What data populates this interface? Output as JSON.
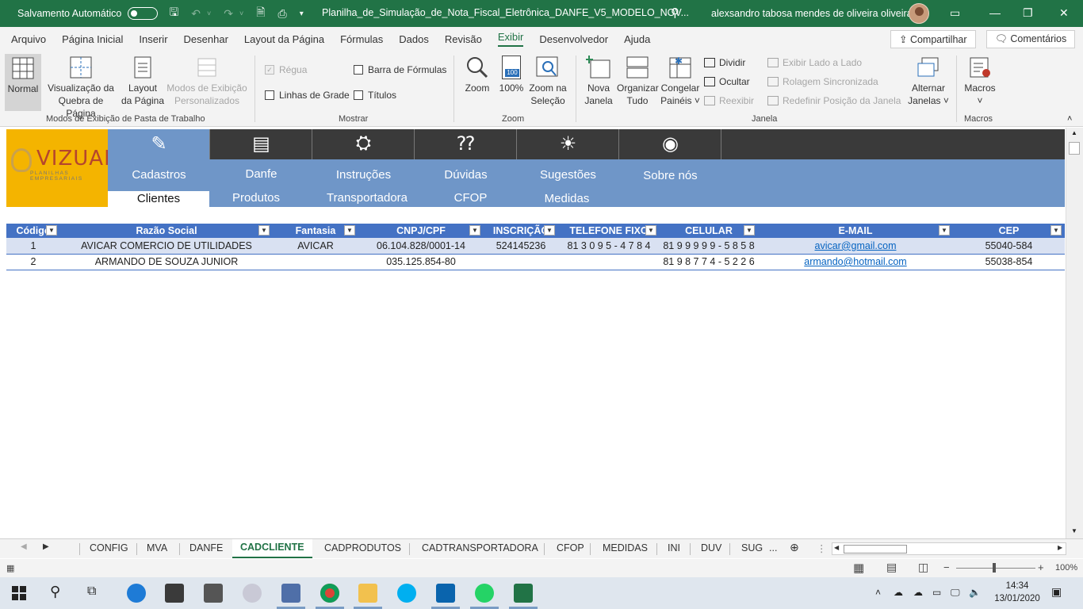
{
  "titlebar": {
    "autosave_label": "Salvamento Automático",
    "doc_title": "Planilha_de_Simulação_de_Nota_Fiscal_Eletrônica_DANFE_V5_MODELO_NOV...",
    "user_name": "alexsandro tabosa mendes de oliveira oliveira"
  },
  "menu": {
    "items": [
      "Arquivo",
      "Página Inicial",
      "Inserir",
      "Desenhar",
      "Layout da Página",
      "Fórmulas",
      "Dados",
      "Revisão",
      "Exibir",
      "Desenvolvedor",
      "Ajuda"
    ],
    "active": "Exibir",
    "share_label": "Compartilhar",
    "comments_label": "Comentários"
  },
  "ribbon": {
    "views": {
      "normal": "Normal",
      "page_break_1": "Visualização da",
      "page_break_2": "Quebra de Página",
      "layout_1": "Layout",
      "layout_2": "da Página",
      "custom_1": "Modos de Exibição",
      "custom_2": "Personalizados",
      "group": "Modos de Exibição de Pasta de Trabalho"
    },
    "show": {
      "ruler": "Régua",
      "formula_bar": "Barra de Fórmulas",
      "gridlines": "Linhas de Grade",
      "headings": "Títulos",
      "group": "Mostrar"
    },
    "zoom": {
      "zoom": "Zoom",
      "hundred": "100%",
      "hundred_icon": "100",
      "selection_1": "Zoom na",
      "selection_2": "Seleção",
      "group": "Zoom"
    },
    "window": {
      "new_1": "Nova",
      "new_2": "Janela",
      "arrange_1": "Organizar",
      "arrange_2": "Tudo",
      "freeze_1": "Congelar",
      "freeze_2": "Painéis ˅",
      "split": "Dividir",
      "hide": "Ocultar",
      "unhide": "Reexibir",
      "side_by_side": "Exibir Lado a Lado",
      "sync_scroll": "Rolagem Sincronizada",
      "reset_pos": "Redefinir Posição da Janela",
      "switch_1": "Alternar",
      "switch_2": "Janelas ˅",
      "group": "Janela"
    },
    "macros": {
      "label": "Macros",
      "caret": "˅",
      "group": "Macros"
    }
  },
  "app_nav": {
    "logo_text": "VIZUAL",
    "logo_tagline": "PLANILHAS EMPRESARIAIS",
    "tabs": [
      "Cadastros",
      "Danfe",
      "Instruções",
      "Dúvidas",
      "Sugestões",
      "Sobre nós"
    ],
    "subtabs": [
      "Clientes",
      "Produtos",
      "Transportadora",
      "CFOP",
      "Medidas"
    ]
  },
  "table": {
    "headers": [
      "Código",
      "Razão Social",
      "Fantasia",
      "CNPJ/CPF",
      "INSCRIÇÃO",
      "TELEFONE FIXO",
      "CELULAR",
      "E-MAIL",
      "CEP"
    ],
    "rows": [
      [
        "1",
        "AVICAR COMERCIO DE UTILIDADES",
        "AVICAR",
        "06.104.828/0001-14",
        "524145236",
        "81 3 0 9 5 - 4 7 8 4",
        "81 9 9 9 9 9 - 5 8 5 8",
        "avicar@gmail.com",
        "55040-584"
      ],
      [
        "2",
        "ARMANDO DE SOUZA JUNIOR",
        "",
        "035.125.854-80",
        "",
        "",
        "81 9 8 7 7 4 - 5 2 2 6",
        "armando@hotmail.com",
        "55038-854"
      ]
    ]
  },
  "sheets": {
    "tabs": [
      "CONFIG",
      "MVA",
      "DANFE",
      "CADCLIENTE",
      "CADPRODUTOS",
      "CADTRANSPORTADORA",
      "CFOP",
      "MEDIDAS",
      "INI",
      "DUV",
      "SUG"
    ],
    "active": "CADCLIENTE",
    "more": "..."
  },
  "status": {
    "zoom": "100%"
  },
  "taskbar": {
    "time": "14:34",
    "date": "13/01/2020"
  },
  "colors": {
    "excel_green": "#217346",
    "nav_blue": "#6f96c8",
    "nav_dark": "#3a3a3a",
    "logo_yellow": "#f4b400",
    "table_header": "#4472c4",
    "row_band": "#d9e1f2"
  }
}
